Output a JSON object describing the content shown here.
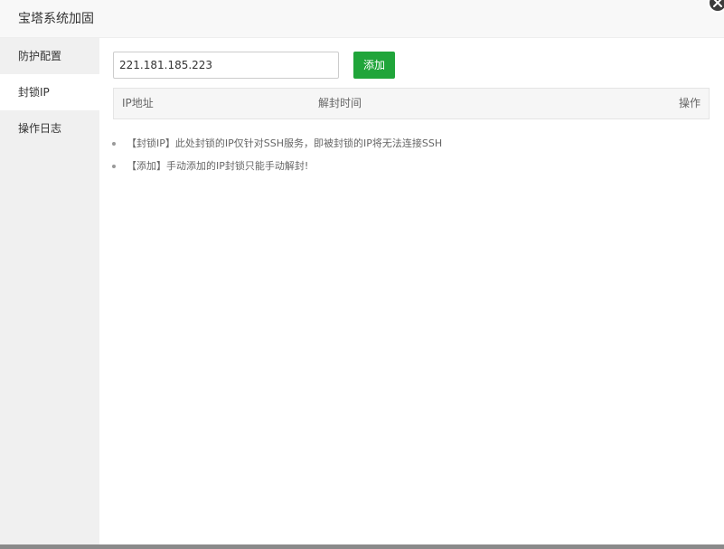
{
  "dialog": {
    "title": "宝塔系统加固",
    "close_icon": "close-icon"
  },
  "sidebar": {
    "items": [
      {
        "label": "防护配置",
        "active": false
      },
      {
        "label": "封锁IP",
        "active": true
      },
      {
        "label": "操作日志",
        "active": false
      }
    ]
  },
  "form": {
    "ip_value": "221.181.185.223",
    "add_label": "添加"
  },
  "table": {
    "columns": [
      "IP地址",
      "解封时间",
      "操作"
    ],
    "rows": []
  },
  "notes": [
    "【封锁IP】此处封锁的IP仅针对SSH服务，即被封锁的IP将无法连接SSH",
    "【添加】手动添加的IP封锁只能手动解封!"
  ],
  "colors": {
    "accent": "#20a53a",
    "sidebar_bg": "#f0f0f0",
    "header_bg": "#f8f8f8"
  }
}
